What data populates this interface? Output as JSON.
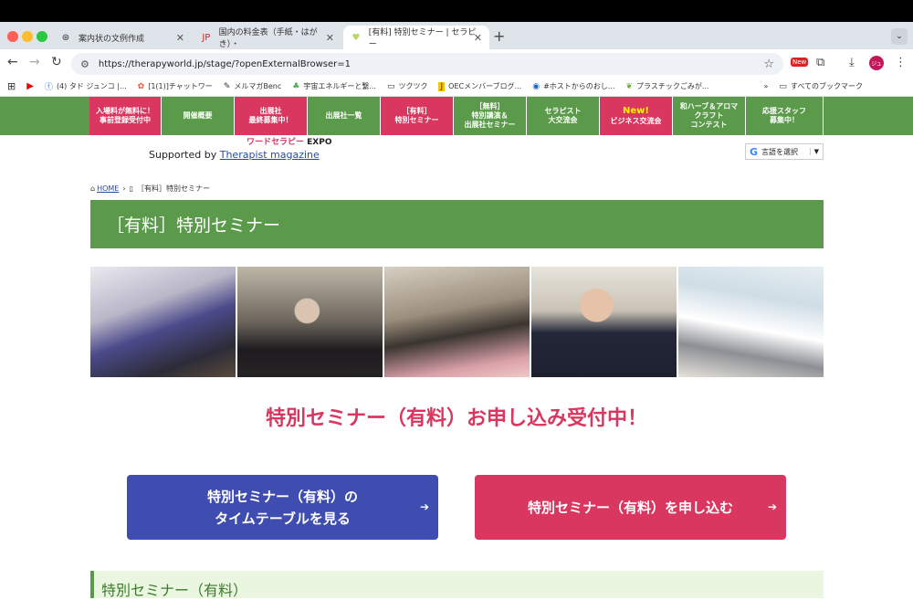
{
  "browser": {
    "tabs": [
      {
        "title": "案内状の文例作成",
        "active": false
      },
      {
        "title": "国内の料金表（手紙・はがき）・",
        "active": false
      },
      {
        "title": "[有料] 特別セミナー | セラピー",
        "active": true
      }
    ],
    "url": "https://therapyworld.jp/stage/?openExternalBrowser=1",
    "bookmarks": [
      {
        "label": "(4) タド ジュンコ |...",
        "icon": "facebook-icon"
      },
      {
        "label": "[1(1)]チャットワー",
        "icon": "chatwork-icon"
      },
      {
        "label": "メルマガBenc",
        "icon": "feather-icon"
      },
      {
        "label": "宇宙エネルギーと繋...",
        "icon": "plant-icon"
      },
      {
        "label": "ツクツク",
        "icon": "folder-icon"
      },
      {
        "label": "OECメンバーブログ...",
        "icon": "j-icon"
      },
      {
        "label": "#ホストからのおし...",
        "icon": "circle-icon"
      },
      {
        "label": "プラスチックごみが...",
        "icon": "leaf-icon"
      }
    ],
    "all_bookmarks": "すべてのブックマーク",
    "new_badge": "New"
  },
  "site": {
    "nav": [
      {
        "lines": [
          "入場料が無料に！",
          "事前登録受付中"
        ],
        "style": "pink"
      },
      {
        "lines": [
          "開催概要"
        ],
        "style": "green"
      },
      {
        "lines": [
          "出展社",
          "最終募集中！"
        ],
        "style": "pink"
      },
      {
        "lines": [
          "出展社一覧"
        ],
        "style": "green"
      },
      {
        "lines": [
          "［有料］",
          "特別セミナー"
        ],
        "style": "pink"
      },
      {
        "lines": [
          "［無料］",
          "特別講演＆",
          "出展社セミナー"
        ],
        "style": "green"
      },
      {
        "lines": [
          "セラピスト",
          "大交流会"
        ],
        "style": "green"
      },
      {
        "lines": [
          "New!",
          "ビジネス交流会"
        ],
        "style": "pink"
      },
      {
        "lines": [
          "和ハーブ＆アロマ",
          "クラフト",
          "コンテスト"
        ],
        "style": "green"
      },
      {
        "lines": [
          "応援スタッフ",
          "募集中！"
        ],
        "style": "green"
      }
    ],
    "logo_fragment": "ワードセラピー",
    "logo_expo": "EXPO",
    "supported_prefix": "Supported by",
    "supported_link": "Therapist magazine",
    "translate_label": "言語を選択",
    "breadcrumb_home": "HOME",
    "breadcrumb_current": "［有料］特別セミナー",
    "page_title": "［有料］特別セミナー",
    "headline": "特別セミナー（有料）お申し込み受付中！",
    "button_timetable_line1": "特別セミナー（有料）の",
    "button_timetable_line2": "タイムテーブルを見る",
    "button_apply": "特別セミナー（有料）を申し込む",
    "section_heading": "特別セミナー（有料）",
    "colors": {
      "green": "#5a9a4a",
      "pink": "#d9375f",
      "blue": "#3f4db0"
    }
  }
}
